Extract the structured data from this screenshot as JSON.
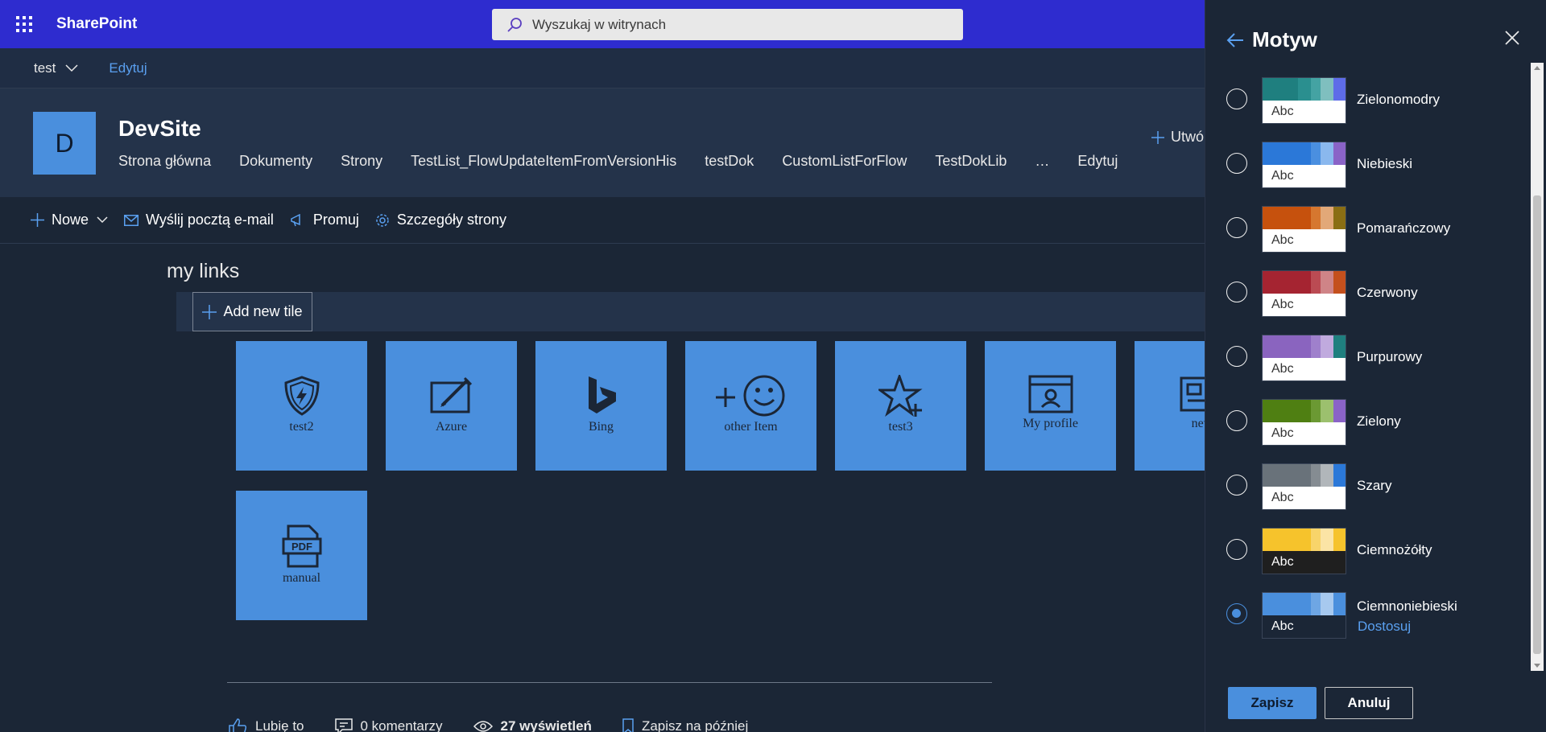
{
  "suitebar": {
    "brand": "SharePoint",
    "search_placeholder": "Wyszukaj w witrynach",
    "accent": "#2e2ccf"
  },
  "hubnav": {
    "site": "test",
    "edit": "Edytuj"
  },
  "site": {
    "logo_letter": "D",
    "title": "DevSite",
    "nav": [
      "Strona główna",
      "Dokumenty",
      "Strony",
      "TestList_FlowUpdateItemFromVersionHis",
      "testDok",
      "CustomListForFlow",
      "TestDokLib",
      "…",
      "Edytuj"
    ],
    "create_label": "Utwó"
  },
  "commandbar": {
    "new": "Nowe",
    "email": "Wyślij pocztą e-mail",
    "promote": "Promuj",
    "details": "Szczegóły strony"
  },
  "webpart": {
    "title": "my links",
    "add_tile": "Add new tile",
    "tiles": [
      {
        "label": "test2",
        "icon": "shield-bolt-icon"
      },
      {
        "label": "Azure",
        "icon": "edit-pen-icon"
      },
      {
        "label": "Bing",
        "icon": "bing-icon"
      },
      {
        "label": "other Item",
        "icon": "add-emoji-icon"
      },
      {
        "label": "test3",
        "icon": "star-add-icon"
      },
      {
        "label": "My profile",
        "icon": "profile-card-icon"
      },
      {
        "label": "new",
        "icon": "news-icon"
      },
      {
        "label": "manual",
        "icon": "pdf-icon"
      }
    ],
    "tile_color": "#4a8fdd"
  },
  "footer": {
    "like": "Lubię to",
    "comments": "0 komentarzy",
    "views": "27 wyświetleń",
    "save_later": "Zapisz na później"
  },
  "panel": {
    "title": "Motyw",
    "themes": [
      {
        "name": "Zielonomodry",
        "colors": [
          "#1f7f7f",
          "#2a8f8f",
          "#44a3a3",
          "#7fbfbf",
          "#5e6ce8"
        ],
        "abc_bg": "#ffffff",
        "abc_fg": "#333333",
        "selected": false
      },
      {
        "name": "Niebieski",
        "colors": [
          "#2b78d8",
          "#2b78d8",
          "#4a8fe0",
          "#8ab8ee",
          "#8a63c7"
        ],
        "abc_bg": "#ffffff",
        "abc_fg": "#333333",
        "selected": false
      },
      {
        "name": "Pomarańczowy",
        "colors": [
          "#c6510d",
          "#c6510d",
          "#d6772f",
          "#e2a878",
          "#8a6e14"
        ],
        "abc_bg": "#ffffff",
        "abc_fg": "#333333",
        "selected": false
      },
      {
        "name": "Czerwony",
        "colors": [
          "#a52431",
          "#a52431",
          "#bb4b53",
          "#cf8487",
          "#c4501d"
        ],
        "abc_bg": "#ffffff",
        "abc_fg": "#333333",
        "selected": false
      },
      {
        "name": "Purpurowy",
        "colors": [
          "#8a64bf",
          "#8a64bf",
          "#9f80cc",
          "#c0aade",
          "#1f7f7f"
        ],
        "abc_bg": "#ffffff",
        "abc_fg": "#333333",
        "selected": false
      },
      {
        "name": "Zielony",
        "colors": [
          "#4f7f12",
          "#4f7f12",
          "#6b9933",
          "#9cc06e",
          "#8a63c7"
        ],
        "abc_bg": "#ffffff",
        "abc_fg": "#333333",
        "selected": false
      },
      {
        "name": "Szary",
        "colors": [
          "#69727a",
          "#69727a",
          "#858c92",
          "#b1b6ba",
          "#2b78d8"
        ],
        "abc_bg": "#ffffff",
        "abc_fg": "#333333",
        "selected": false
      },
      {
        "name": "Ciemnożółty",
        "colors": [
          "#f6c32c",
          "#f6c32c",
          "#f8d46a",
          "#fbe4a5",
          "#f6c32c"
        ],
        "abc_bg": "#1f1f1f",
        "abc_fg": "#ffffff",
        "selected": false
      },
      {
        "name": "Ciemnoniebieski",
        "colors": [
          "#4a8fdd",
          "#4a8fdd",
          "#6ea6e4",
          "#a7c9ef",
          "#4a8fdd"
        ],
        "abc_bg": "#1b2636",
        "abc_fg": "#ffffff",
        "selected": true,
        "customize": "Dostosuj"
      }
    ],
    "abc": "Abc",
    "save": "Zapisz",
    "cancel": "Anuluj"
  }
}
